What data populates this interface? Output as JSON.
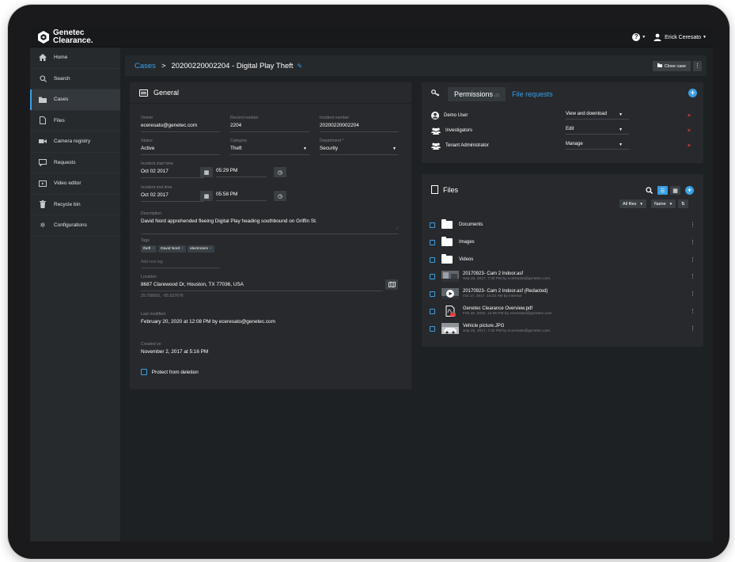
{
  "app": {
    "brand_line1": "Genetec",
    "brand_line2": "Clearance.",
    "user_name": "Erick Ceresato",
    "help_symbol": "?",
    "accent_color": "#3a9ee4",
    "danger_color": "#e53935"
  },
  "sidebar": {
    "items": [
      {
        "label": "Home",
        "icon": "home-icon"
      },
      {
        "label": "Search",
        "icon": "search-icon"
      },
      {
        "label": "Cases",
        "icon": "folder-icon",
        "active": true
      },
      {
        "label": "Files",
        "icon": "file-icon"
      },
      {
        "label": "Camera registry",
        "icon": "camera-icon"
      },
      {
        "label": "Requests",
        "icon": "chat-icon"
      },
      {
        "label": "Video editor",
        "icon": "video-editor-icon"
      },
      {
        "label": "Recycle bin",
        "icon": "trash-icon"
      },
      {
        "label": "Configurations",
        "icon": "gear-icon"
      }
    ]
  },
  "header": {
    "breadcrumb_root": "Cases",
    "breadcrumb_sep": ">",
    "case_title": "20200220002204 - Digital Play Theft",
    "close_case_label": "Close case",
    "more_symbol": "⋮"
  },
  "general": {
    "title": "General",
    "owner_label": "Owner",
    "owner_value": "eceresato@genetec.com",
    "record_label": "Record number",
    "record_value": "2204",
    "incident_label": "Incident number",
    "incident_value": "20200220002204",
    "status_label": "Status",
    "status_value": "Active",
    "category_label": "Category",
    "category_value": "Theft",
    "department_label": "Department *",
    "department_value": "Security",
    "start_label": "Incident start time",
    "start_date": "Oct 02 2017",
    "start_time": "05:29 PM",
    "end_label": "Incident end time",
    "end_date": "Oct 02 2017",
    "end_time": "05:58 PM",
    "description_label": "Description",
    "description_value": "David Nord apprehended fleeing Digital Play heading southbound on Griffin St.",
    "tags_label": "Tags",
    "tags": [
      "theft",
      "David Nord",
      "electronics"
    ],
    "tag_remove_symbol": "×",
    "add_tag_placeholder": "Add new tag",
    "location_label": "Location",
    "location_value": "8687 Clarewood Dr, Houston, TX 77036, USA",
    "coordinates": "29.708601, -95.537676",
    "modified_label": "Last modified",
    "modified_value": "February 20, 2020 at 12:08 PM by eceresato@genetec.com",
    "created_label": "Created on",
    "created_value": "November 2, 2017 at 5:16 PM",
    "protect_label": "Protect from deletion"
  },
  "permissions": {
    "tab_permissions": "Permissions",
    "tab_permissions_count": "(3)",
    "tab_requests": "File requests",
    "rows": [
      {
        "name": "Demo User",
        "role": "View and download",
        "kind": "user"
      },
      {
        "name": "Investigators",
        "role": "Edit",
        "kind": "group"
      },
      {
        "name": "Tenant Administrator",
        "role": "Manage",
        "kind": "group"
      }
    ],
    "remove_symbol": "×"
  },
  "files": {
    "title": "Files",
    "filter_label": "All files",
    "sort_label": "Name",
    "sort_symbol": "⇅",
    "items": [
      {
        "name": "Documents",
        "meta": "",
        "type": "folder"
      },
      {
        "name": "Images",
        "meta": "",
        "type": "folder"
      },
      {
        "name": "Videos",
        "meta": "",
        "type": "folder"
      },
      {
        "name": "20170923- Cam 2 Indoor.asf",
        "meta": "Sep 25, 2017, 7:33 PM by eceresato@genetec.com",
        "type": "video"
      },
      {
        "name": "20170923- Cam 2 Indoor.asf (Redacted)",
        "meta": "Oct 17, 2017, 10:22 AM by internal",
        "type": "video-play"
      },
      {
        "name": "Genetec Clearance Overview.pdf",
        "meta": "Feb 20, 2020, 12:06 PM by eceresato@genetec.com",
        "type": "pdf"
      },
      {
        "name": "Vehicle picture.JPG",
        "meta": "Sep 25, 2017, 7:32 PM by eceresato@genetec.com",
        "type": "image"
      }
    ],
    "row_more_symbol": "⋮"
  }
}
